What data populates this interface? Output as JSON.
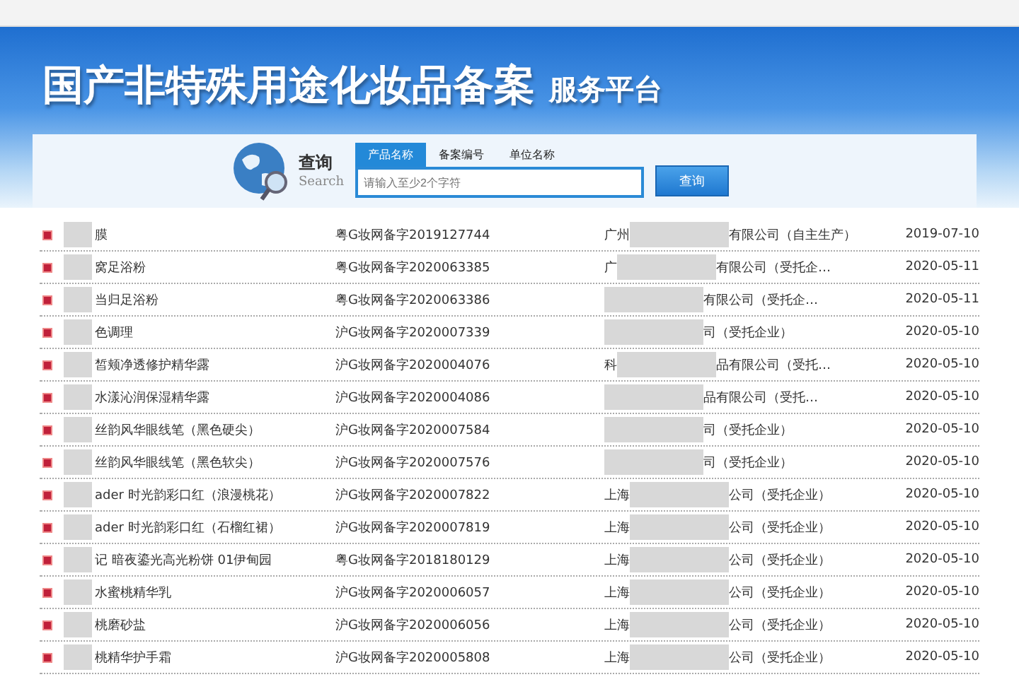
{
  "banner": {
    "title": "国产非特殊用途化妆品备案",
    "subtitle": "服务平台"
  },
  "search": {
    "label": "查询",
    "label_en": "Search",
    "tabs": [
      {
        "label": "产品名称",
        "selected": true
      },
      {
        "label": "备案编号",
        "selected": false
      },
      {
        "label": "单位名称",
        "selected": false
      }
    ],
    "placeholder": "请输入至少2个字符",
    "button": "查询"
  },
  "rows": [
    {
      "product": "膜",
      "code": "粤G妆网备字2019127744",
      "company_start": "广州",
      "company_end": "有限公司（自主生产）",
      "date": "2019-07-10"
    },
    {
      "product": "窝足浴粉",
      "code": "粤G妆网备字2020063385",
      "company_start": "广",
      "company_end": "有限公司（受托企…",
      "date": "2020-05-11"
    },
    {
      "product": "当归足浴粉",
      "code": "粤G妆网备字2020063386",
      "company_start": "",
      "company_end": "有限公司（受托企…",
      "date": "2020-05-11"
    },
    {
      "product": "色调理",
      "code": "沪G妆网备字2020007339",
      "company_start": "",
      "company_end": "司（受托企业）",
      "date": "2020-05-10"
    },
    {
      "product": "皙颊净透修护精华露",
      "code": "沪G妆网备字2020004076",
      "company_start": "科",
      "company_end": "品有限公司（受托…",
      "date": "2020-05-10"
    },
    {
      "product": "水漾沁润保湿精华露",
      "code": "沪G妆网备字2020004086",
      "company_start": "",
      "company_end": "品有限公司（受托…",
      "date": "2020-05-10"
    },
    {
      "product": "丝韵风华眼线笔（黑色硬尖）",
      "code": "沪G妆网备字2020007584",
      "company_start": "",
      "company_end": "司（受托企业）",
      "date": "2020-05-10"
    },
    {
      "product": "丝韵风华眼线笔（黑色软尖）",
      "code": "沪G妆网备字2020007576",
      "company_start": "",
      "company_end": "司（受托企业）",
      "date": "2020-05-10"
    },
    {
      "product": "ader 时光韵彩口红（浪漫桃花）",
      "code": "沪G妆网备字2020007822",
      "company_start": "上海",
      "company_end": "公司（受托企业）",
      "date": "2020-05-10"
    },
    {
      "product": "ader 时光韵彩口红（石榴红裙）",
      "code": "沪G妆网备字2020007819",
      "company_start": "上海",
      "company_end": "公司（受托企业）",
      "date": "2020-05-10"
    },
    {
      "product": "记 暗夜鎏光高光粉饼 01伊甸园",
      "code": "粤G妆网备字2018180129",
      "company_start": "上海",
      "company_end": "公司（受托企业）",
      "date": "2020-05-10"
    },
    {
      "product": "水蜜桃精华乳",
      "code": "沪G妆网备字2020006057",
      "company_start": "上海",
      "company_end": "公司（受托企业）",
      "date": "2020-05-10"
    },
    {
      "product": "桃磨砂盐",
      "code": "沪G妆网备字2020006056",
      "company_start": "上海",
      "company_end": "公司（受托企业）",
      "date": "2020-05-10"
    },
    {
      "product": "桃精华护手霜",
      "code": "沪G妆网备字2020005808",
      "company_start": "上海",
      "company_end": "公司（受托企业）",
      "date": "2020-05-10"
    }
  ]
}
